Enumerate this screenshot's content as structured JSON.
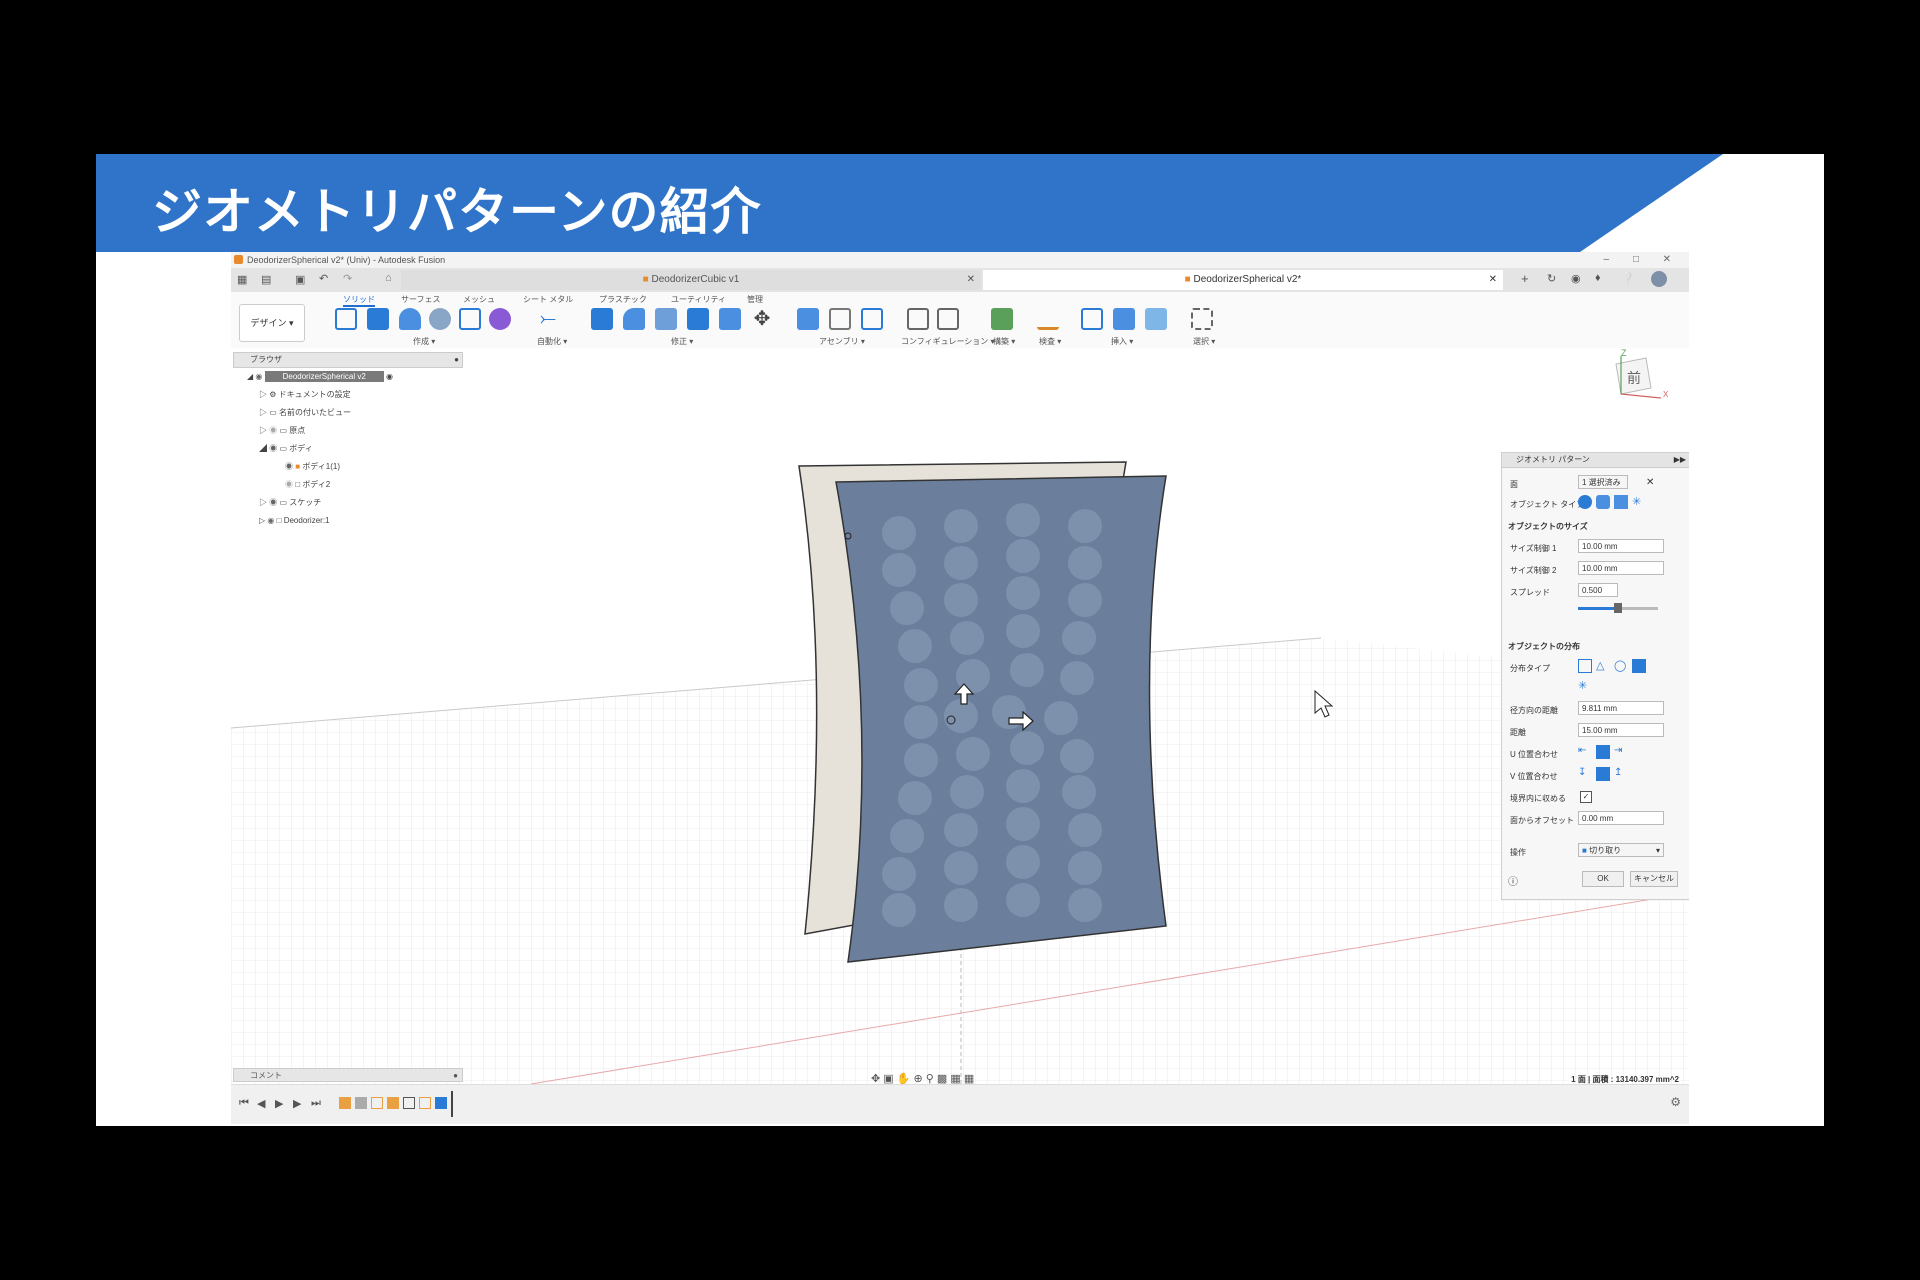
{
  "slide": {
    "title": "ジオメトリパターンの紹介",
    "accent": "#2f74c8"
  },
  "window": {
    "title": "DeodorizerSpherical v2* (Univ) - Autodesk Fusion",
    "tabs": [
      {
        "label": "DeodorizerCubic v1"
      },
      {
        "label": "DeodorizerSpherical v2*"
      }
    ]
  },
  "ribbon": {
    "design_label": "デザイン ▾",
    "tabs": [
      "ソリッド",
      "サーフェス",
      "メッシュ",
      "シート メタル",
      "プラスチック",
      "ユーティリティ",
      "管理"
    ],
    "groups": [
      "作成 ▾",
      "自動化 ▾",
      "修正 ▾",
      "アセンブリ ▾",
      "コンフィギュレーション ▾",
      "構築 ▾",
      "検査 ▾",
      "挿入 ▾",
      "選択 ▾"
    ]
  },
  "browser": {
    "header": "ブラウザ",
    "root": "DeodorizerSpherical v2",
    "items": [
      {
        "label": "ドキュメントの設定"
      },
      {
        "label": "名前の付いたビュー"
      },
      {
        "label": "原点"
      },
      {
        "label": "ボディ"
      },
      {
        "label": "ボディ1(1)"
      },
      {
        "label": "ボディ2"
      },
      {
        "label": "スケッチ"
      },
      {
        "label": "Deodorizer:1"
      }
    ]
  },
  "viewcube": {
    "label": "前",
    "z": "Z",
    "x": "X"
  },
  "panel": {
    "title": "ジオメトリ パターン",
    "face_label": "面",
    "selected": "1 選択済み",
    "object_type_label": "オブジェクト タイプ",
    "section_size": "オブジェクトのサイズ",
    "size1_label": "サイズ制御 1",
    "size1_value": "10.00 mm",
    "size2_label": "サイズ制御 2",
    "size2_value": "10.00 mm",
    "spread_label": "スプレッド",
    "spread_value": "0.500",
    "spread_fraction": 0.5,
    "section_dist": "オブジェクトの分布",
    "dist_type_label": "分布タイプ",
    "radial_dist_label": "径方向の距離",
    "radial_dist_value": "9.811 mm",
    "distance_label": "距離",
    "distance_value": "15.00 mm",
    "u_align_label": "U 位置合わせ",
    "v_align_label": "V 位置合わせ",
    "inside_boundary_label": "境界内に収める",
    "offset_label": "面からオフセット",
    "offset_value": "0.00 mm",
    "operation_label": "操作",
    "operation_value": "切り取り",
    "ok_label": "OK",
    "cancel_label": "キャンセル"
  },
  "comment_label": "コメント",
  "status": "1 面 | 面積 : 13140.397 mm^2"
}
